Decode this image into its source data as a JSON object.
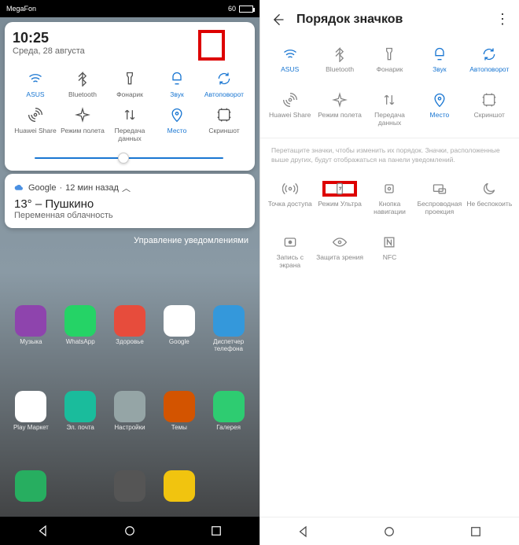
{
  "left": {
    "statusbar": {
      "carrier": "MegaFon",
      "battery": "60"
    },
    "panel": {
      "time": "10:25",
      "date": "Среда, 28 августа",
      "tiles_row1": [
        {
          "name": "wifi",
          "label": "ASUS",
          "active": true
        },
        {
          "name": "bluetooth",
          "label": "Bluetooth",
          "active": false
        },
        {
          "name": "flashlight",
          "label": "Фонарик",
          "active": false
        },
        {
          "name": "sound",
          "label": "Звук",
          "active": true
        },
        {
          "name": "autorotate",
          "label": "Автоповорот",
          "active": true
        }
      ],
      "tiles_row2": [
        {
          "name": "huaweishare",
          "label": "Huawei Share",
          "active": false
        },
        {
          "name": "airplane",
          "label": "Режим полета",
          "active": false
        },
        {
          "name": "data",
          "label": "Передача данных",
          "active": false
        },
        {
          "name": "location",
          "label": "Место",
          "active": true
        },
        {
          "name": "screenshot",
          "label": "Скриншот",
          "active": false
        }
      ]
    },
    "weather": {
      "source": "Google",
      "age": "12 мин назад",
      "temp": "13° – Пушкино",
      "cond": "Переменная облачность"
    },
    "notif_mgr": "Управление уведомлениями",
    "apps_row1": [
      {
        "label": "Музыка",
        "bg": "#8e44ad"
      },
      {
        "label": "WhatsApp",
        "bg": "#25d366"
      },
      {
        "label": "Здоровье",
        "bg": "#e74c3c"
      },
      {
        "label": "Google",
        "bg": "#fff"
      },
      {
        "label": "Диспетчер телефона",
        "bg": "#3498db"
      }
    ],
    "apps_row2": [
      {
        "label": "Play Маркет",
        "bg": "#fff"
      },
      {
        "label": "Эл. почта",
        "bg": "#1abc9c"
      },
      {
        "label": "Настройки",
        "bg": "#95a5a6"
      },
      {
        "label": "Темы",
        "bg": "#d35400"
      },
      {
        "label": "Галерея",
        "bg": "#2ecc71"
      }
    ],
    "apps_row3": [
      {
        "label": "",
        "bg": "#27ae60"
      },
      {
        "label": "",
        "bg": ""
      },
      {
        "label": "",
        "bg": "#555"
      },
      {
        "label": "",
        "bg": "#f1c40f"
      },
      {
        "label": "",
        "bg": ""
      }
    ]
  },
  "right": {
    "title": "Порядок значков",
    "tiles_row1": [
      {
        "name": "wifi",
        "label": "ASUS",
        "active": true
      },
      {
        "name": "bluetooth",
        "label": "Bluetooth",
        "active": false
      },
      {
        "name": "flashlight",
        "label": "Фонарик",
        "active": false
      },
      {
        "name": "sound",
        "label": "Звук",
        "active": true
      },
      {
        "name": "autorotate",
        "label": "Автоповорот",
        "active": true
      }
    ],
    "tiles_row2": [
      {
        "name": "huaweishare",
        "label": "Huawei Share",
        "active": false
      },
      {
        "name": "airplane",
        "label": "Режим полета",
        "active": false
      },
      {
        "name": "data",
        "label": "Передача данных",
        "active": false
      },
      {
        "name": "location",
        "label": "Место",
        "active": true
      },
      {
        "name": "screenshot",
        "label": "Скриншот",
        "active": false
      }
    ],
    "hint": "Перетащите значки, чтобы изменить их порядок. Значки, расположенные выше других, будут отображаться на панели уведомлений.",
    "tiles_row3": [
      {
        "name": "hotspot",
        "label": "Точка доступа"
      },
      {
        "name": "ultra",
        "label": "Режим Ультра",
        "highlight": true
      },
      {
        "name": "navkey",
        "label": "Кнопка навигации"
      },
      {
        "name": "wireless-proj",
        "label": "Беспроводная проекция"
      },
      {
        "name": "dnd",
        "label": "Не беспокоить"
      }
    ],
    "tiles_row4": [
      {
        "name": "screenrec",
        "label": "Запись с экрана"
      },
      {
        "name": "eyecare",
        "label": "Защита зрения"
      },
      {
        "name": "nfc",
        "label": "NFC"
      }
    ]
  }
}
